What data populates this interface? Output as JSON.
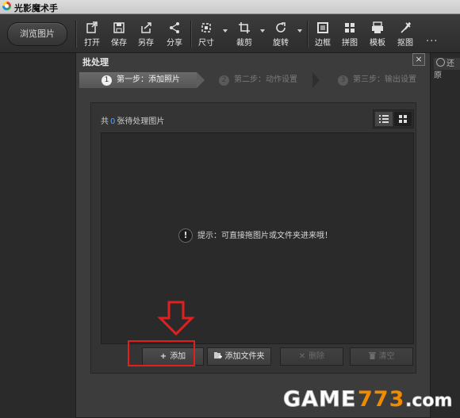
{
  "app": {
    "title": "光影魔术手"
  },
  "toolbar": {
    "browse_label": "浏览图片",
    "tools": [
      {
        "label": "打开",
        "icon": "open-icon"
      },
      {
        "label": "保存",
        "icon": "save-icon"
      },
      {
        "label": "另存",
        "icon": "save-as-icon"
      },
      {
        "label": "分享",
        "icon": "share-icon"
      },
      {
        "label": "尺寸",
        "icon": "resize-icon"
      },
      {
        "label": "裁剪",
        "icon": "crop-icon"
      },
      {
        "label": "旋转",
        "icon": "rotate-icon"
      },
      {
        "label": "边框",
        "icon": "border-icon"
      },
      {
        "label": "拼图",
        "icon": "collage-icon"
      },
      {
        "label": "模板",
        "icon": "template-icon"
      },
      {
        "label": "抠图",
        "icon": "cutout-icon"
      }
    ],
    "more": "···"
  },
  "restore_label": "还原",
  "dialog": {
    "title": "批处理",
    "close": "×",
    "steps": [
      {
        "num": "1",
        "label": "第一步：添加照片",
        "state": "active"
      },
      {
        "num": "2",
        "label": "第二步：动作设置",
        "state": "inactive"
      },
      {
        "num": "3",
        "label": "第三步：输出设置",
        "state": "inactive"
      }
    ],
    "count_prefix": "共",
    "count_value": "0",
    "count_suffix": "张待处理图片",
    "hint_icon": "!",
    "hint": "提示：可直接拖图片或文件夹进来哦！",
    "buttons": {
      "add": {
        "icon": "+",
        "label": "添加"
      },
      "add_folder": {
        "label": "添加文件夹"
      },
      "delete": {
        "icon": "✕",
        "label": "删除"
      },
      "clear": {
        "label": "清空"
      }
    }
  },
  "colors": {
    "highlight": "#e02020",
    "count": "#4fa6ff"
  },
  "watermark": "GAME773.com"
}
